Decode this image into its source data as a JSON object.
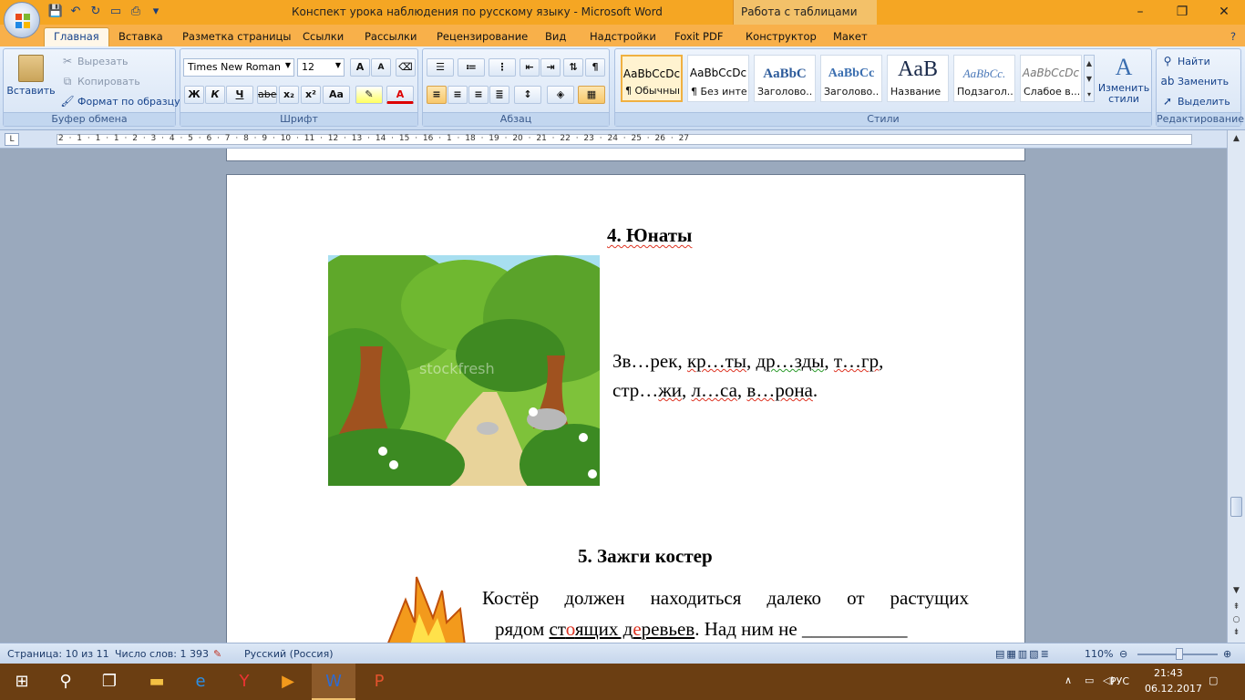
{
  "window": {
    "title": "Конспект урока наблюдения по русскому языку - Microsoft Word",
    "contextual_tab": "Работа с таблицами",
    "minimize": "–",
    "maximize": "❐",
    "close": "✕"
  },
  "tabs": [
    "Главная",
    "Вставка",
    "Разметка страницы",
    "Ссылки",
    "Рассылки",
    "Рецензирование",
    "Вид",
    "Надстройки",
    "Foxit PDF",
    "Конструктор",
    "Макет"
  ],
  "ribbon": {
    "clipboard": {
      "label": "Буфер обмена",
      "paste": "Вставить",
      "cut": "Вырезать",
      "copy": "Копировать",
      "format_painter": "Формат по образцу"
    },
    "font": {
      "label": "Шрифт",
      "font_name": "Times New Roman",
      "font_size": "12",
      "bold": "Ж",
      "italic": "К",
      "underline": "Ч",
      "strike": "abe",
      "subscript": "x₂",
      "superscript": "x²",
      "change_case": "Aa",
      "grow": "A",
      "shrink": "A"
    },
    "paragraph": {
      "label": "Абзац"
    },
    "styles": {
      "label": "Стили",
      "items": [
        {
          "preview": "AaBbCcDc",
          "name": "¶ Обычный"
        },
        {
          "preview": "AaBbCcDc",
          "name": "¶ Без инте..."
        },
        {
          "preview": "AaBbC",
          "name": "Заголово..."
        },
        {
          "preview": "AaBbCc",
          "name": "Заголово..."
        },
        {
          "preview": "AaB",
          "name": "Название"
        },
        {
          "preview": "AaBbCc.",
          "name": "Подзагол..."
        },
        {
          "preview": "AaBbCcDc",
          "name": "Слабое в..."
        }
      ],
      "change_styles": "Изменить стили"
    },
    "editing": {
      "label": "Редактирование",
      "find": "Найти",
      "replace": "Заменить",
      "select": "Выделить"
    }
  },
  "ruler": {
    "ticks": "2 · 1 · 1 · 1 · 2 · 3 · 4 · 5 · 6 · 7 · 8 · 9 · 10 · 11 · 12 · 13 · 14 · 15 · 16 · 1 · 18 · 19 · 20 · 21 · 22 · 23 · 24 · 25 · 26 · 27"
  },
  "document": {
    "heading4": "4. Юнаты",
    "image1_watermark": "stockfresh",
    "words_line1": [
      "Зв…рек",
      ", ",
      "кр…ты",
      ", ",
      "др…зды",
      ", ",
      "т…гр",
      ","
    ],
    "words_line2": [
      "стр…",
      "жи",
      ", ",
      "л…са",
      ", ",
      "в…рона",
      "."
    ],
    "heading5": "5. Зажги костер",
    "para_line1": "Костёр должен находиться далеко от растущих",
    "para_line2_a": "рядом ",
    "para_line2_st": "ст",
    "para_line2_o": "о",
    "para_line2_yash": "ящих д",
    "para_line2_e": "е",
    "para_line2_rev": "ревьев",
    "para_line2_b": ". Над ним не ___________"
  },
  "status": {
    "page": "Страница: 10 из 11",
    "words": "Число слов: 1 393",
    "language": "Русский (Россия)",
    "zoom": "110%"
  },
  "taskbar": {
    "lang": "РУС",
    "time": "21:43",
    "date": "06.12.2017"
  },
  "colors": {
    "titlebar": "#f5a623",
    "ribbon": "#d7e4f5",
    "taskbar": "#6b3e12",
    "spell_error": "#dd3322"
  }
}
